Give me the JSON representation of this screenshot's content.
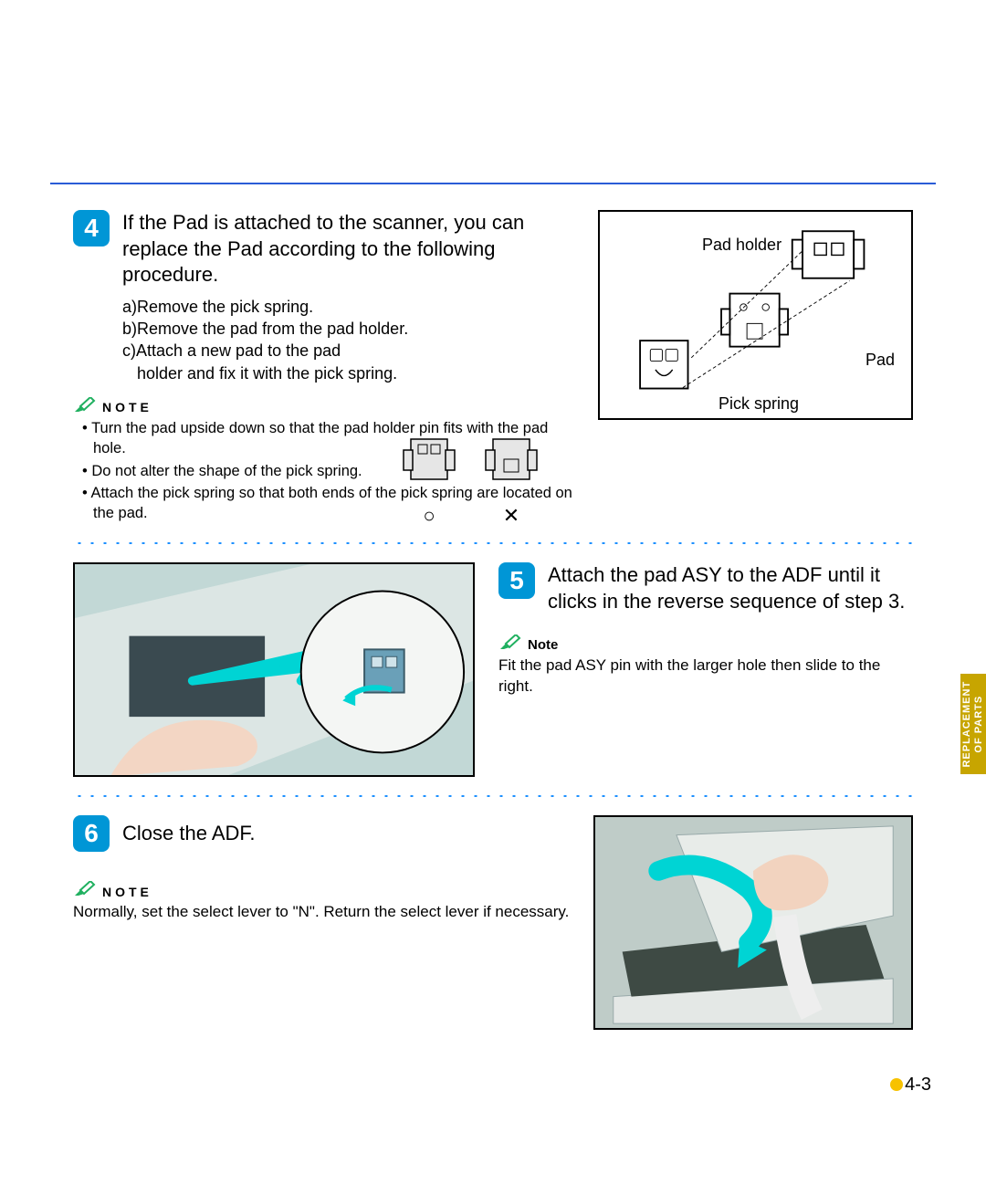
{
  "step4": {
    "num": "4",
    "title": "If the Pad is attached to the scanner, you can replace the Pad according to the following procedure.",
    "a": "a)Remove the pick spring.",
    "b": "b)Remove the pad from the pad holder.",
    "c1": "c)Attach a new pad to the pad",
    "c2": "holder and fix it with the pick spring.",
    "note_label": "NOTE",
    "note_items": [
      "Turn the pad upside down so that the pad holder pin fits with the pad hole.",
      "Do not alter the shape of the pick spring.",
      "Attach the pick spring so that both ends of the pick spring are located on the pad."
    ],
    "diagram_labels": {
      "pad_holder": "Pad holder",
      "pad": "Pad",
      "pick_spring": "Pick spring"
    },
    "ok_mark": "○",
    "ng_mark": "✕"
  },
  "step5": {
    "num": "5",
    "title": "Attach the pad ASY to the ADF until it clicks in the reverse sequence of step 3.",
    "note_label": "Note",
    "note_text": "Fit the pad ASY pin with the larger hole then slide to the right."
  },
  "step6": {
    "num": "6",
    "title": "Close the ADF.",
    "note_label": "NOTE",
    "note_text": "Normally, set the select lever to \"N\". Return the select lever if necessary."
  },
  "side_tab": {
    "line1": "REPLACEMENT",
    "line2": "OF PARTS"
  },
  "page_number": "4-3"
}
